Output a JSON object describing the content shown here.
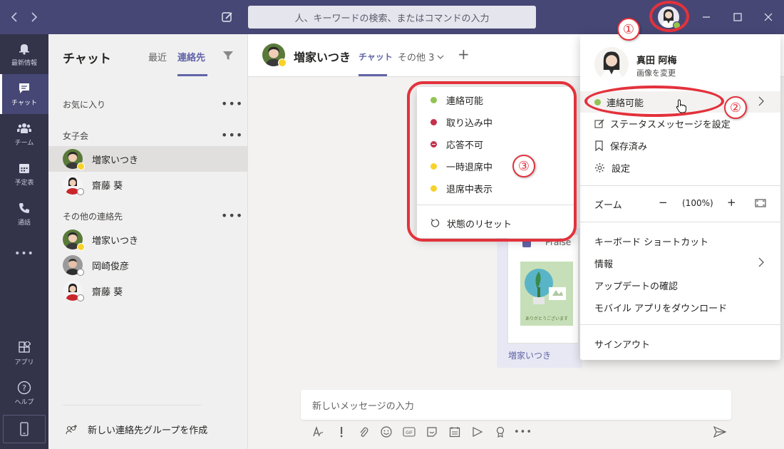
{
  "search": {
    "placeholder": "人、キーワードの検索、またはコマンドの入力"
  },
  "appbar": {
    "items": [
      {
        "label": "最新情報",
        "icon": "bell-icon"
      },
      {
        "label": "チャット",
        "icon": "chat-icon"
      },
      {
        "label": "チーム",
        "icon": "teams-icon"
      },
      {
        "label": "予定表",
        "icon": "calendar-icon"
      },
      {
        "label": "通話",
        "icon": "phone-icon"
      },
      {
        "label": "アプリ",
        "icon": "apps-icon"
      },
      {
        "label": "ヘルプ",
        "icon": "help-icon"
      }
    ],
    "more": "•••"
  },
  "chatlist": {
    "title": "チャット",
    "tab_recent": "最近",
    "tab_contacts": "連絡先",
    "sections": [
      {
        "title": "お気に入り",
        "contacts": []
      },
      {
        "title": "女子会",
        "contacts": [
          {
            "name": "増家いつき",
            "status": "away"
          },
          {
            "name": "齋藤 葵",
            "status": "offline"
          }
        ]
      },
      {
        "title": "その他の連絡先",
        "contacts": [
          {
            "name": "増家いつき",
            "status": "away"
          },
          {
            "name": "岡崎俊彦",
            "status": "offline"
          },
          {
            "name": "齋藤 葵",
            "status": "offline"
          }
        ]
      }
    ],
    "more": "•••",
    "new_group": "新しい連絡先グループを作成"
  },
  "main": {
    "contact_name": "増家いつき",
    "tab_chat": "チャット",
    "tab_more": "その他 3",
    "add": "+",
    "card_title": "Praise",
    "card_caption": "ありがとうございます",
    "sender": "増家いつき",
    "compose_placeholder": "新しいメッセージの入力"
  },
  "profile": {
    "name": "真田 阿梅",
    "change_image": "画像を変更",
    "status": "連絡可能",
    "status_message": "ステータスメッセージを設定",
    "saved": "保存済み",
    "settings": "設定",
    "zoom_label": "ズーム",
    "zoom_minus": "−",
    "zoom_value": "(100%)",
    "zoom_plus": "+",
    "shortcuts": "キーボード ショートカット",
    "info": "情報",
    "updates": "アップデートの確認",
    "mobile": "モバイル アプリをダウンロード",
    "signout": "サインアウト"
  },
  "status_menu": {
    "items": [
      {
        "label": "連絡可能",
        "color": "#92c353"
      },
      {
        "label": "取り込み中",
        "color": "#c4314b"
      },
      {
        "label": "応答不可",
        "color": "#c4314b"
      },
      {
        "label": "一時退席中",
        "color": "#f8d22a"
      },
      {
        "label": "退席中表示",
        "color": "#f8d22a"
      }
    ],
    "reset": "状態のリセット"
  },
  "annotations": {
    "n1": "①",
    "n2": "②",
    "n3": "③"
  },
  "colors": {
    "brand": "#464775",
    "accent": "#6264a7",
    "annotation": "#e3323c",
    "available": "#92c353",
    "away": "#f8d22a"
  }
}
